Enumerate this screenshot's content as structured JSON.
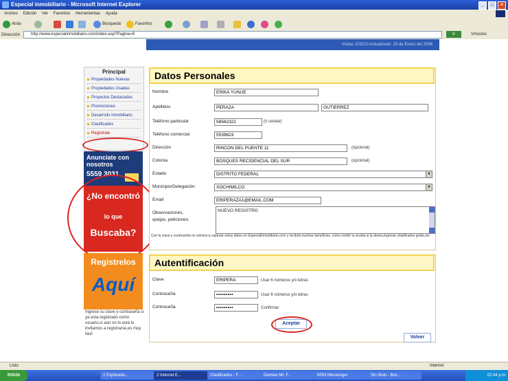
{
  "window": {
    "title": "Especial inmobiliario - Microsoft Internet Explorer"
  },
  "menu": [
    "Archivo",
    "Edición",
    "Ver",
    "Favoritos",
    "Herramientas",
    "Ayuda"
  ],
  "toolbar": {
    "back": "Atrás",
    "search": "Búsqueda",
    "favorites": "Favoritos"
  },
  "address": {
    "label": "Dirección",
    "url": "http://www.especialinmobiliario.com/index.asp?Pagina=8",
    "go": "Ir",
    "links": "Vínculos"
  },
  "banner": {
    "text": "Visitas 203223 Actualizado: 25 de Enero del 2006"
  },
  "sidebar": {
    "heading": "Principal",
    "items": [
      {
        "label": "Propiedades Nuevas"
      },
      {
        "label": "Propiedades Usadas"
      },
      {
        "label": "Proyectos Destacados"
      },
      {
        "label": "Promociones"
      },
      {
        "label": "Desarrollo Inmobiliario"
      },
      {
        "label": "Clasificados"
      },
      {
        "label": "Registrate"
      }
    ],
    "ad1": {
      "title": "Anunciate con nosotros",
      "phone": "5559 3031"
    },
    "ad2": {
      "a": "¿No encontró",
      "b": "lo que",
      "c": "Buscaba?"
    },
    "ad3": {
      "r": "Registrelos",
      "q": "Aquí"
    },
    "text": "Ingrese su clave y contraseña si ya esta registrado como usuario,si aún no lo está lo invitamos a registrarse,es muy facil"
  },
  "personal": {
    "heading": "Datos Personales",
    "nombre_label": "Nombre",
    "nombre": "ERIKA YUNUE",
    "apellidos_label": "Apellidos",
    "apellido1": "PERAZA",
    "apellido2": "GUTIERREZ",
    "tel_part_label": "Teléfono particular",
    "tel_part": "56562321",
    "tel_part_hint": "(ó celular)",
    "tel_com_label": "Teléfono comercial",
    "tel_com": "5539623",
    "direccion_label": "Dirección",
    "direccion": "RINCON DEL PUENTE 11",
    "opcional": "(opcional)",
    "colonia_label": "Colonia",
    "colonia": "BOSQUES RECIDENCIAL DEL SUR",
    "estado_label": "Estado",
    "estado": "DISTRITO FEDERAL",
    "municipio_label": "Municipio/Delegación",
    "municipio": "XOCHIMILCO",
    "email_label": "Email",
    "email": "ERIPERAZA1@EMAIL.COM",
    "obs_label": "Observaciones, quejas, peticiones.",
    "obs": "NUEVO REGISTRO",
    "note": "Con la clave y contraseña no volverá a capturar estos datos en EspecialInmobiliario.com y recibirá muchos beneficios, como recibir la revista si la desea,ingresar clasificados gratis,etc."
  },
  "auth": {
    "heading": "Autentificación",
    "clave_label": "Clave",
    "clave": "ERIPERA",
    "clave_hint": "Usar 6 números y/o letras",
    "pass_label": "Contraseña",
    "pass": "•••••••••",
    "pass_hint": "Usar 6 números y/o letras",
    "pass2_label": "Contraseña",
    "pass2": "•••••••••",
    "pass2_hint": "Confirmar",
    "accept": "Aceptar",
    "back": "Volver"
  },
  "status": {
    "text": "Listo",
    "zone": "Internet"
  },
  "taskbar": {
    "start": "Inicio",
    "tasks": [
      "2 Explorado...",
      "2 Internet E...",
      "Clasificados - F...",
      "Demian Mt. F...",
      "MSN Messenger",
      "Sin título - Boc..."
    ],
    "clock": "02:44 p.m."
  }
}
